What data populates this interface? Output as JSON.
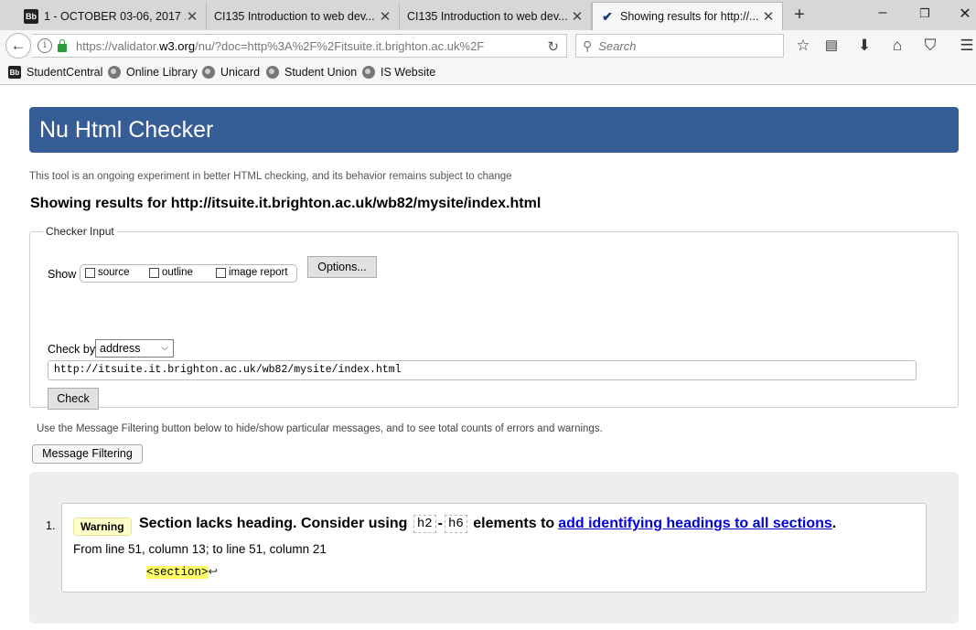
{
  "browser": {
    "tabs": [
      {
        "title": "1 - OCTOBER 03-06, 2017 ...",
        "favicon": "Bb",
        "active": false
      },
      {
        "title": "CI135 Introduction to web dev...",
        "favicon": "",
        "active": false
      },
      {
        "title": "CI135 Introduction to web dev...",
        "favicon": "",
        "active": false
      },
      {
        "title": "Showing results for http://...",
        "favicon": "w3c",
        "active": true
      }
    ],
    "url_prefix": "https://validator.",
    "url_domain": "w3.org",
    "url_rest": "/nu/?doc=http%3A%2F%2Fitsuite.it.brighton.ac.uk%2F",
    "search_placeholder": "Search",
    "bookmarks": [
      {
        "label": "StudentCentral",
        "icon": "blackboard-icon"
      },
      {
        "label": "Online Library",
        "icon": "globe-icon"
      },
      {
        "label": "Unicard",
        "icon": "globe-icon"
      },
      {
        "label": "Student Union",
        "icon": "globe-icon"
      },
      {
        "label": "IS Website",
        "icon": "globe-icon"
      }
    ]
  },
  "page": {
    "banner_title": "Nu Html Checker",
    "subtitle": "This tool is an ongoing experiment in better HTML checking, and its behavior remains subject to change",
    "results_title": "Showing results for http://itsuite.it.brighton.ac.uk/wb82/mysite/index.html",
    "checker": {
      "legend": "Checker Input",
      "show_label": "Show",
      "options": [
        "source",
        "outline",
        "image report"
      ],
      "options_button": "Options...",
      "checkby_label": "Check by",
      "checkby_value": "address",
      "url_value": "http://itsuite.it.brighton.ac.uk/wb82/mysite/index.html",
      "check_button": "Check"
    },
    "filter_note": "Use the Message Filtering button below to hide/show particular messages, and to see total counts of errors and warnings.",
    "filter_button": "Message Filtering",
    "messages": [
      {
        "number": "1.",
        "type": "Warning",
        "text_before": "Section lacks heading. Consider using",
        "code1": "h2",
        "separator": "-",
        "code2": "h6",
        "text_after": "elements to",
        "link_text": "add identifying headings to all sections",
        "period": ".",
        "location": "From line 51, column 13; to line 51, column 21",
        "extract": "<section>",
        "extract_tail": "↩"
      }
    ]
  }
}
